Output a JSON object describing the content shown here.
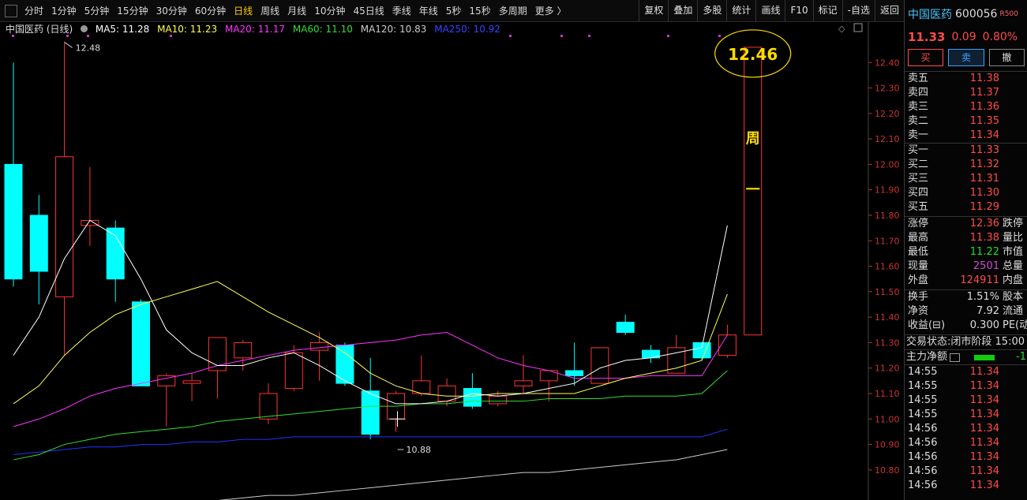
{
  "toolbar": {
    "periods": [
      "分时",
      "1分钟",
      "5分钟",
      "15分钟",
      "30分钟",
      "60分钟",
      "日线",
      "周线",
      "月线",
      "10分钟",
      "45日线",
      "季线",
      "年线",
      "5秒",
      "15秒",
      "多周期",
      "更多 〉"
    ],
    "active": "日线",
    "tools": [
      "复权",
      "叠加",
      "多股",
      "统计",
      "画线",
      "F10",
      "标记",
      "-自选",
      "返回"
    ]
  },
  "legend": {
    "title": "中国医药 (日线)",
    "ma5": "MA5: 11.28",
    "ma10": "MA10: 11.23",
    "ma20": "MA20: 11.17",
    "ma60": "MA60: 11.10",
    "ma120": "MA120: 10.83",
    "ma250": "MA250: 10.92"
  },
  "colors": {
    "up": "#ff3333",
    "down": "#00ffff",
    "ma5": "#ffffff",
    "ma10": "#ffff55",
    "ma20": "#ff33ff",
    "ma60": "#33dd33",
    "ma120": "#cccccc",
    "ma250": "#2233ff",
    "annotation": "#ffdd00"
  },
  "annotations": {
    "high_label": "12.48",
    "low_label": "10.88",
    "ellipse_price": "12.46",
    "weekly_text_1": "周",
    "weekly_text_2": "一"
  },
  "chart_data": {
    "type": "candlestick",
    "ylim": [
      10.75,
      12.5
    ],
    "yticks": [
      12.4,
      12.3,
      12.2,
      12.1,
      12.0,
      11.9,
      11.8,
      11.7,
      11.6,
      11.5,
      11.4,
      11.3,
      11.2,
      11.1,
      11.0,
      10.9,
      10.8
    ],
    "candles": [
      {
        "o": 12.0,
        "h": 12.4,
        "l": 11.52,
        "c": 11.55
      },
      {
        "o": 11.8,
        "h": 11.88,
        "l": 11.45,
        "c": 11.58
      },
      {
        "o": 11.48,
        "h": 12.48,
        "l": 11.25,
        "c": 12.03
      },
      {
        "o": 11.76,
        "h": 11.99,
        "l": 11.68,
        "c": 11.78
      },
      {
        "o": 11.75,
        "h": 11.78,
        "l": 11.46,
        "c": 11.55
      },
      {
        "o": 11.46,
        "h": 11.47,
        "l": 11.13,
        "c": 11.13
      },
      {
        "o": 11.13,
        "h": 11.18,
        "l": 10.97,
        "c": 11.17
      },
      {
        "o": 11.14,
        "h": 11.18,
        "l": 11.07,
        "c": 11.15
      },
      {
        "o": 11.19,
        "h": 11.32,
        "l": 11.08,
        "c": 11.32
      },
      {
        "o": 11.24,
        "h": 11.31,
        "l": 11.19,
        "c": 11.3
      },
      {
        "o": 11.0,
        "h": 11.14,
        "l": 10.98,
        "c": 11.1
      },
      {
        "o": 11.12,
        "h": 11.29,
        "l": 11.11,
        "c": 11.26
      },
      {
        "o": 11.27,
        "h": 11.34,
        "l": 11.15,
        "c": 11.3
      },
      {
        "o": 11.29,
        "h": 11.3,
        "l": 11.13,
        "c": 11.14
      },
      {
        "o": 11.11,
        "h": 11.24,
        "l": 10.92,
        "c": 10.94
      },
      {
        "o": 11.0,
        "h": 11.11,
        "l": 10.95,
        "c": 11.1
      },
      {
        "o": 11.1,
        "h": 11.25,
        "l": 11.09,
        "c": 11.15
      },
      {
        "o": 11.07,
        "h": 11.16,
        "l": 11.05,
        "c": 11.13
      },
      {
        "o": 11.12,
        "h": 11.18,
        "l": 11.04,
        "c": 11.05
      },
      {
        "o": 11.06,
        "h": 11.11,
        "l": 11.05,
        "c": 11.09
      },
      {
        "o": 11.13,
        "h": 11.25,
        "l": 11.1,
        "c": 11.15
      },
      {
        "o": 11.15,
        "h": 11.19,
        "l": 11.07,
        "c": 11.19
      },
      {
        "o": 11.19,
        "h": 11.3,
        "l": 11.13,
        "c": 11.17
      },
      {
        "o": 11.14,
        "h": 11.28,
        "l": 11.14,
        "c": 11.28
      },
      {
        "o": 11.38,
        "h": 11.41,
        "l": 11.33,
        "c": 11.34
      },
      {
        "o": 11.27,
        "h": 11.29,
        "l": 11.22,
        "c": 11.24
      },
      {
        "o": 11.18,
        "h": 11.33,
        "l": 11.18,
        "c": 11.28
      },
      {
        "o": 11.3,
        "h": 11.3,
        "l": 11.23,
        "c": 11.24
      },
      {
        "o": 11.25,
        "h": 11.37,
        "l": 11.24,
        "c": 11.33
      },
      {
        "o": 11.33,
        "h": 12.46,
        "l": 11.33,
        "c": 12.46
      }
    ],
    "ma5": [
      11.25,
      11.4,
      11.63,
      11.78,
      11.72,
      11.55,
      11.35,
      11.26,
      11.21,
      11.21,
      11.24,
      11.26,
      11.21,
      11.15,
      11.1,
      11.06,
      11.06,
      11.07,
      11.1,
      11.09,
      11.1,
      11.12,
      11.14,
      11.2,
      11.23,
      11.24,
      11.26,
      11.28,
      11.76
    ],
    "ma10": [
      11.06,
      11.13,
      11.25,
      11.34,
      11.41,
      11.45,
      11.48,
      11.51,
      11.54,
      11.48,
      11.42,
      11.37,
      11.32,
      11.26,
      11.18,
      11.13,
      11.1,
      11.09,
      11.09,
      11.1,
      11.1,
      11.1,
      11.1,
      11.13,
      11.16,
      11.18,
      11.2,
      11.23,
      11.49
    ],
    "ma20": [
      10.97,
      11.0,
      11.04,
      11.09,
      11.12,
      11.14,
      11.16,
      11.18,
      11.21,
      11.23,
      11.25,
      11.27,
      11.28,
      11.29,
      11.3,
      11.31,
      11.33,
      11.34,
      11.29,
      11.24,
      11.21,
      11.19,
      11.16,
      11.16,
      11.16,
      11.17,
      11.17,
      11.17,
      11.33
    ],
    "ma60": [
      10.84,
      10.86,
      10.9,
      10.92,
      10.94,
      10.95,
      10.96,
      10.97,
      10.99,
      11.0,
      11.01,
      11.02,
      11.03,
      11.04,
      11.05,
      11.05,
      11.06,
      11.06,
      11.07,
      11.07,
      11.07,
      11.08,
      11.08,
      11.08,
      11.09,
      11.09,
      11.09,
      11.1,
      11.19
    ],
    "ma120": [
      10.6,
      10.61,
      10.62,
      10.63,
      10.64,
      10.65,
      10.66,
      10.67,
      10.68,
      10.69,
      10.7,
      10.7,
      10.71,
      10.72,
      10.73,
      10.74,
      10.75,
      10.76,
      10.77,
      10.78,
      10.79,
      10.79,
      10.8,
      10.81,
      10.82,
      10.83,
      10.84,
      10.86,
      10.88
    ],
    "ma250": [
      10.86,
      10.87,
      10.88,
      10.89,
      10.89,
      10.9,
      10.9,
      10.91,
      10.91,
      10.92,
      10.92,
      10.93,
      10.93,
      10.93,
      10.93,
      10.93,
      10.93,
      10.93,
      10.93,
      10.93,
      10.93,
      10.93,
      10.93,
      10.93,
      10.93,
      10.93,
      10.93,
      10.93,
      10.96
    ]
  },
  "quote": {
    "name": "中国医药",
    "code": "600056",
    "badge": "R500",
    "price": "11.33",
    "change": "0.09",
    "pct": "0.80%",
    "buy_label": "买",
    "sell_label": "卖",
    "cancel_label": "撤"
  },
  "orderbook": {
    "asks": [
      {
        "label": "卖五",
        "price": "11.38"
      },
      {
        "label": "卖四",
        "price": "11.37"
      },
      {
        "label": "卖三",
        "price": "11.36"
      },
      {
        "label": "卖二",
        "price": "11.35"
      },
      {
        "label": "卖一",
        "price": "11.34"
      }
    ],
    "bids": [
      {
        "label": "买一",
        "price": "11.33"
      },
      {
        "label": "买二",
        "price": "11.32"
      },
      {
        "label": "买三",
        "price": "11.31"
      },
      {
        "label": "买四",
        "price": "11.30"
      },
      {
        "label": "买五",
        "price": "11.29"
      }
    ]
  },
  "stats": [
    {
      "label": "涨停",
      "value": "12.36",
      "tail": "跌停",
      "color": "red"
    },
    {
      "label": "最高",
      "value": "11.38",
      "tail": "量比",
      "color": "red"
    },
    {
      "label": "最低",
      "value": "11.22",
      "tail": "市值",
      "color": "green"
    },
    {
      "label": "现量",
      "value": "2501",
      "tail": "总量",
      "color": "purple"
    },
    {
      "label": "外盘",
      "value": "124911",
      "tail": "内盘",
      "color": "red"
    }
  ],
  "stats2": [
    {
      "label": "换手",
      "value": "1.51%",
      "tail": "股本"
    },
    {
      "label": "净资",
      "value": "7.92",
      "tail": "流通"
    },
    {
      "label": "收益(⊟)",
      "value": "0.300",
      "tail": "PE(动"
    }
  ],
  "trade_status": {
    "label": "交易状态:",
    "value": "闭市阶段 15:00"
  },
  "capital": {
    "label": "主力净额",
    "value": "-1"
  },
  "ticks": [
    {
      "t": "14:55",
      "p": "11.34"
    },
    {
      "t": "14:55",
      "p": "11.34"
    },
    {
      "t": "14:55",
      "p": "11.34"
    },
    {
      "t": "14:55",
      "p": "11.34"
    },
    {
      "t": "14:56",
      "p": "11.34"
    },
    {
      "t": "14:56",
      "p": "11.34"
    },
    {
      "t": "14:56",
      "p": "11.34"
    },
    {
      "t": "14:56",
      "p": "11.34"
    },
    {
      "t": "14:56",
      "p": "11.34"
    }
  ]
}
